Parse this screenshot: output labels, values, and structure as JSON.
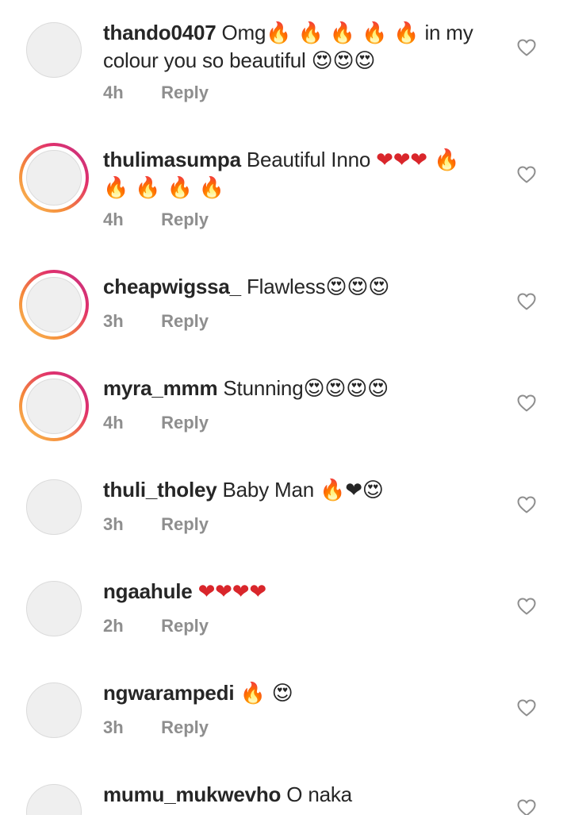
{
  "comments": [
    {
      "username": "thando0407",
      "text": "Omg",
      "emoji": "🔥 🔥 🔥 🔥 🔥",
      "text2": "in my colour you so beautiful",
      "emoji2": "😍😍😍",
      "time": "4h",
      "reply": "Reply"
    },
    {
      "username": "thulimasumpa",
      "text": "Beautiful Inno",
      "emoji": "❤❤❤ 🔥 🔥 🔥 🔥 🔥",
      "time": "4h",
      "reply": "Reply"
    },
    {
      "username": "cheapwigssa_",
      "text": "Flawless",
      "emoji": "😍😍😍",
      "time": "3h",
      "reply": "Reply"
    },
    {
      "username": "myra_mmm",
      "text": "Stunning",
      "emoji": "😍😍😍😍",
      "time": "4h",
      "reply": "Reply"
    },
    {
      "username": "thuli_tholey",
      "text": "Baby Man",
      "emoji": "🔥❤😍",
      "time": "3h",
      "reply": "Reply"
    },
    {
      "username": "ngaahule",
      "text": "",
      "emoji": "❤❤❤❤",
      "time": "2h",
      "reply": "Reply"
    },
    {
      "username": "ngwarampedi",
      "text": "",
      "emoji": "🔥 😍",
      "time": "3h",
      "reply": "Reply"
    },
    {
      "username": "mumu_mukwevho",
      "text": "O naka",
      "emoji": "",
      "time": "",
      "reply": ""
    }
  ],
  "icons": {
    "like": "heart-outline-icon",
    "avatar": "profile-avatar"
  },
  "colors": {
    "text": "#262626",
    "meta": "#8e8e8e",
    "heart": "#8e8e8e",
    "story_ring_start": "#f9c15a",
    "story_ring_end": "#c13584"
  }
}
